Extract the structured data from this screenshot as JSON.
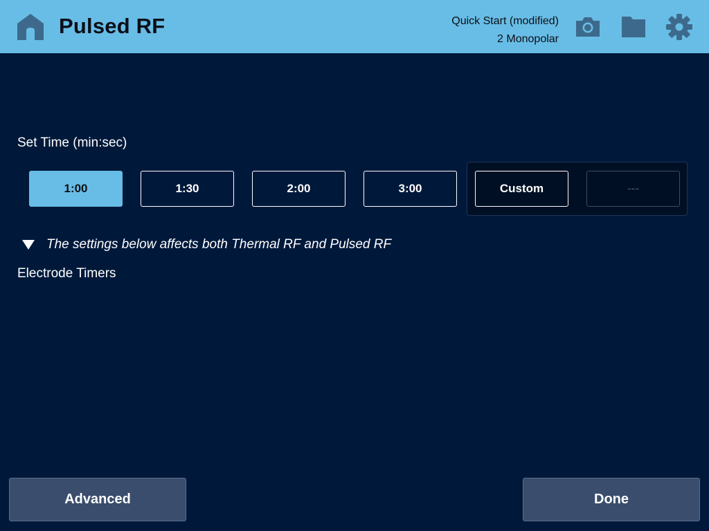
{
  "header": {
    "title": "Pulsed RF",
    "preset_name": "Quick Start (modified)",
    "preset_mode": "2 Monopolar",
    "icons": {
      "home": "home-icon",
      "camera": "camera-icon",
      "folder": "folder-icon",
      "settings": "gear-icon"
    }
  },
  "set_time": {
    "label": "Set Time (min:sec)",
    "options": [
      {
        "label": "1:00",
        "selected": true
      },
      {
        "label": "1:30",
        "selected": false
      },
      {
        "label": "2:00",
        "selected": false
      },
      {
        "label": "3:00",
        "selected": false
      }
    ],
    "custom_label": "Custom",
    "custom_value": "---"
  },
  "note": {
    "text": "The settings below affects both Thermal RF and Pulsed RF",
    "icon": "triangle-down-icon"
  },
  "electrode_timers": {
    "label": "Electrode Timers"
  },
  "footer": {
    "advanced_label": "Advanced",
    "done_label": "Done"
  },
  "colors": {
    "background": "#00193b",
    "header": "#68bde6",
    "selected": "#68bde6",
    "icon": "#3d6a8c",
    "bottom_button": "#3a4d6c"
  }
}
